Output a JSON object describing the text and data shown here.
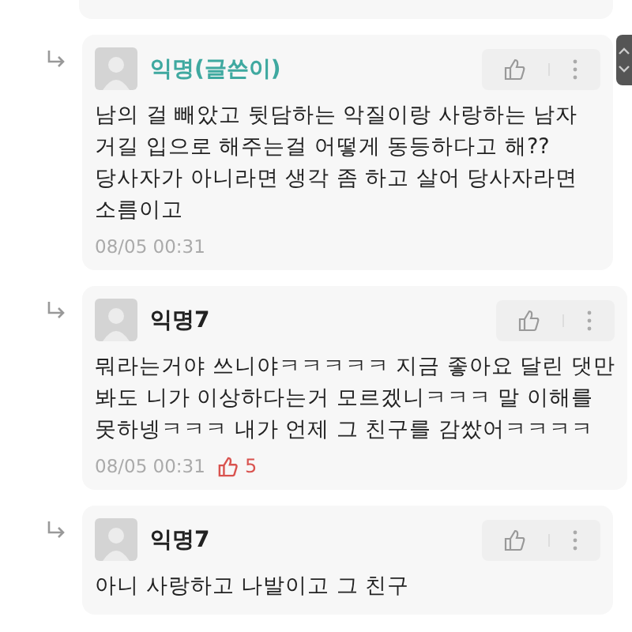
{
  "comments": [
    {
      "author": "익명(글쓴이)",
      "is_writer": true,
      "lines": [
        "남의 걸 빼았고 뒷담하는 악질이랑 사랑하는 남자",
        "거길 입으로 해주는걸 어떻게 동등하다고 해??",
        "당사자가 아니라면 생각 좀 하고 살어 당사자라면",
        "소름이고"
      ],
      "time": "08/05 00:31"
    },
    {
      "author": "익명7",
      "is_writer": false,
      "lines": [
        "뭐라는거야 쓰니야ㅋㅋㅋㅋㅋ 지금 좋아요 달린 댓만",
        "봐도 니가 이상하다는거 모르겠니ㅋㅋㅋ 말 이해를",
        "못하넹ㅋㅋㅋ 내가 언제 그 친구를 감쌌어ㅋㅋㅋㅋ"
      ],
      "time": "08/05 00:31",
      "likes": "5"
    },
    {
      "author": "익명7",
      "is_writer": false,
      "lines": [
        "아니 사랑하고 나발이고 그 친구"
      ]
    }
  ]
}
